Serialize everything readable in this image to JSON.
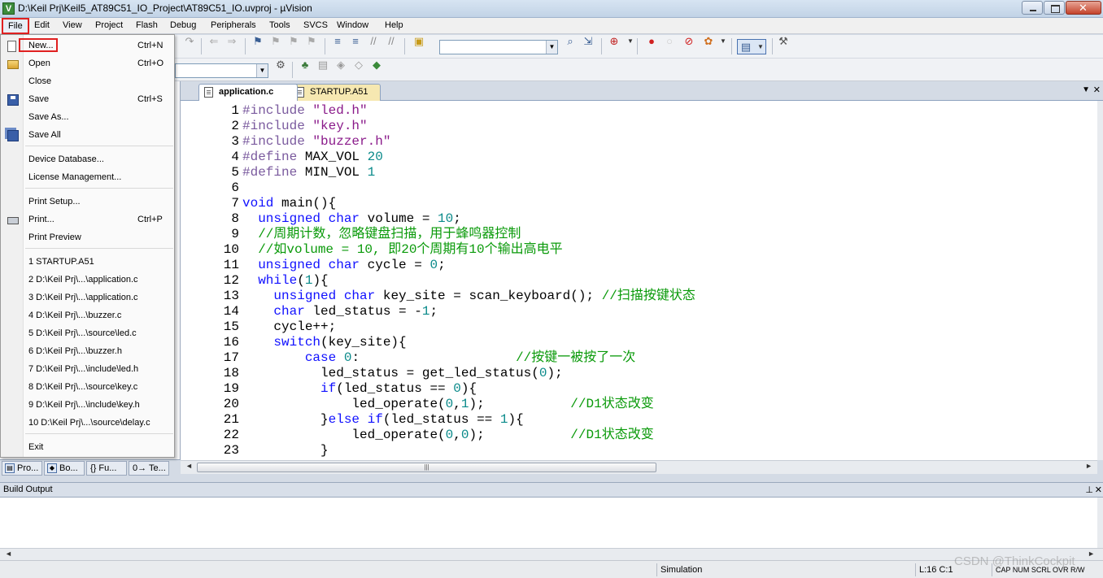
{
  "window": {
    "title": "D:\\Keil Prj\\Keil5_AT89C51_IO_Project\\AT89C51_IO.uvproj - µVision",
    "app_icon": "V"
  },
  "menubar": [
    "File",
    "Edit",
    "View",
    "Project",
    "Flash",
    "Debug",
    "Peripherals",
    "Tools",
    "SVCS",
    "Window",
    "Help"
  ],
  "file_menu": {
    "items": [
      {
        "label": "New...",
        "shortcut": "Ctrl+N",
        "icon": "new-doc-icon"
      },
      {
        "label": "Open",
        "shortcut": "Ctrl+O",
        "icon": "open-folder-icon"
      },
      {
        "label": "Close",
        "shortcut": "",
        "icon": ""
      },
      {
        "label": "Save",
        "shortcut": "Ctrl+S",
        "icon": "save-icon"
      },
      {
        "label": "Save As...",
        "shortcut": "",
        "icon": ""
      },
      {
        "label": "Save All",
        "shortcut": "",
        "icon": "save-all-icon"
      },
      {
        "label": "Device Database...",
        "shortcut": "",
        "icon": ""
      },
      {
        "label": "License Management...",
        "shortcut": "",
        "icon": ""
      },
      {
        "label": "Print Setup...",
        "shortcut": "",
        "icon": ""
      },
      {
        "label": "Print...",
        "shortcut": "Ctrl+P",
        "icon": "print-icon"
      },
      {
        "label": "Print Preview",
        "shortcut": "",
        "icon": ""
      },
      {
        "label": "1 STARTUP.A51",
        "shortcut": "",
        "icon": ""
      },
      {
        "label": "2 D:\\Keil Prj\\...\\application.c",
        "shortcut": "",
        "icon": ""
      },
      {
        "label": "3 D:\\Keil Prj\\...\\application.c",
        "shortcut": "",
        "icon": ""
      },
      {
        "label": "4 D:\\Keil Prj\\...\\buzzer.c",
        "shortcut": "",
        "icon": ""
      },
      {
        "label": "5 D:\\Keil Prj\\...\\source\\led.c",
        "shortcut": "",
        "icon": ""
      },
      {
        "label": "6 D:\\Keil Prj\\...\\buzzer.h",
        "shortcut": "",
        "icon": ""
      },
      {
        "label": "7 D:\\Keil Prj\\...\\include\\led.h",
        "shortcut": "",
        "icon": ""
      },
      {
        "label": "8 D:\\Keil Prj\\...\\source\\key.c",
        "shortcut": "",
        "icon": ""
      },
      {
        "label": "9 D:\\Keil Prj\\...\\include\\key.h",
        "shortcut": "",
        "icon": ""
      },
      {
        "label": "10 D:\\Keil Prj\\...\\source\\delay.c",
        "shortcut": "",
        "icon": ""
      },
      {
        "label": "Exit",
        "shortcut": "",
        "icon": ""
      }
    ]
  },
  "tabs": [
    {
      "label": "application.c",
      "active": true
    },
    {
      "label": "STARTUP.A51",
      "active": false
    }
  ],
  "project_tabs": [
    "Pro...",
    "Bo...",
    "{} Fu...",
    "0→ Te..."
  ],
  "code_lines": [
    [
      {
        "t": "#include ",
        "c": "pp"
      },
      {
        "t": "\"led.h\"",
        "c": "str"
      }
    ],
    [
      {
        "t": "#include ",
        "c": "pp"
      },
      {
        "t": "\"key.h\"",
        "c": "str"
      }
    ],
    [
      {
        "t": "#include ",
        "c": "pp"
      },
      {
        "t": "\"buzzer.h\"",
        "c": "str"
      }
    ],
    [
      {
        "t": "#define ",
        "c": "pp"
      },
      {
        "t": "MAX_VOL ",
        "c": ""
      },
      {
        "t": "20",
        "c": "num"
      }
    ],
    [
      {
        "t": "#define ",
        "c": "pp"
      },
      {
        "t": "MIN_VOL ",
        "c": ""
      },
      {
        "t": "1",
        "c": "num"
      }
    ],
    [],
    [
      {
        "t": "void",
        "c": "kw"
      },
      {
        "t": " main(){",
        "c": ""
      }
    ],
    [
      {
        "t": "  ",
        "c": ""
      },
      {
        "t": "unsigned char",
        "c": "kw"
      },
      {
        "t": " volume = ",
        "c": ""
      },
      {
        "t": "10",
        "c": "num"
      },
      {
        "t": ";",
        "c": ""
      }
    ],
    [
      {
        "t": "  //周期计数，忽略键盘扫描，用于蜂鸣器控制",
        "c": "cm"
      }
    ],
    [
      {
        "t": "  //如volume = 10, 即20个周期有10个输出高电平",
        "c": "cm"
      }
    ],
    [
      {
        "t": "  ",
        "c": ""
      },
      {
        "t": "unsigned char",
        "c": "kw"
      },
      {
        "t": " cycle = ",
        "c": ""
      },
      {
        "t": "0",
        "c": "num"
      },
      {
        "t": ";",
        "c": ""
      }
    ],
    [
      {
        "t": "  ",
        "c": ""
      },
      {
        "t": "while",
        "c": "kw"
      },
      {
        "t": "(",
        "c": ""
      },
      {
        "t": "1",
        "c": "num"
      },
      {
        "t": "){",
        "c": ""
      }
    ],
    [
      {
        "t": "    ",
        "c": ""
      },
      {
        "t": "unsigned char",
        "c": "kw"
      },
      {
        "t": " key_site = scan_keyboard(); ",
        "c": ""
      },
      {
        "t": "//扫描按键状态",
        "c": "cm"
      }
    ],
    [
      {
        "t": "    ",
        "c": ""
      },
      {
        "t": "char",
        "c": "kw"
      },
      {
        "t": " led_status = -",
        "c": ""
      },
      {
        "t": "1",
        "c": "num"
      },
      {
        "t": ";",
        "c": ""
      }
    ],
    [
      {
        "t": "    cycle++;",
        "c": ""
      }
    ],
    [
      {
        "t": "    ",
        "c": ""
      },
      {
        "t": "switch",
        "c": "kw"
      },
      {
        "t": "(key_site){",
        "c": ""
      }
    ],
    [
      {
        "t": "        ",
        "c": ""
      },
      {
        "t": "case ",
        "c": "kw"
      },
      {
        "t": "0",
        "c": "num"
      },
      {
        "t": ":                    ",
        "c": ""
      },
      {
        "t": "//按键一被按了一次",
        "c": "cm"
      }
    ],
    [
      {
        "t": "          led_status = get_led_status(",
        "c": ""
      },
      {
        "t": "0",
        "c": "num"
      },
      {
        "t": ");",
        "c": ""
      }
    ],
    [
      {
        "t": "          ",
        "c": ""
      },
      {
        "t": "if",
        "c": "kw"
      },
      {
        "t": "(led_status == ",
        "c": ""
      },
      {
        "t": "0",
        "c": "num"
      },
      {
        "t": "){",
        "c": ""
      }
    ],
    [
      {
        "t": "              led_operate(",
        "c": ""
      },
      {
        "t": "0",
        "c": "num"
      },
      {
        "t": ",",
        "c": ""
      },
      {
        "t": "1",
        "c": "num"
      },
      {
        "t": ");           ",
        "c": ""
      },
      {
        "t": "//D1状态改变",
        "c": "cm"
      }
    ],
    [
      {
        "t": "          }",
        "c": ""
      },
      {
        "t": "else if",
        "c": "kw"
      },
      {
        "t": "(led_status == ",
        "c": ""
      },
      {
        "t": "1",
        "c": "num"
      },
      {
        "t": "){",
        "c": ""
      }
    ],
    [
      {
        "t": "              led_operate(",
        "c": ""
      },
      {
        "t": "0",
        "c": "num"
      },
      {
        "t": ",",
        "c": ""
      },
      {
        "t": "0",
        "c": "num"
      },
      {
        "t": ");           ",
        "c": ""
      },
      {
        "t": "//D1状态改变",
        "c": "cm"
      }
    ],
    [
      {
        "t": "          }",
        "c": ""
      }
    ]
  ],
  "build_output": {
    "title": "Build Output"
  },
  "statusbar": {
    "mode": "Simulation",
    "position": "L:16 C:1",
    "flags": "CAP  NUM  SCRL  OVR  R/W"
  },
  "watermark": "CSDN @ThinkCockpit",
  "colors": {
    "keyword": "#1010ff",
    "preprocessor": "#7a5a9e",
    "string": "#8a1a8a",
    "number": "#0a8a8a",
    "comment": "#0a9a0a",
    "highlight": "#e02020"
  }
}
